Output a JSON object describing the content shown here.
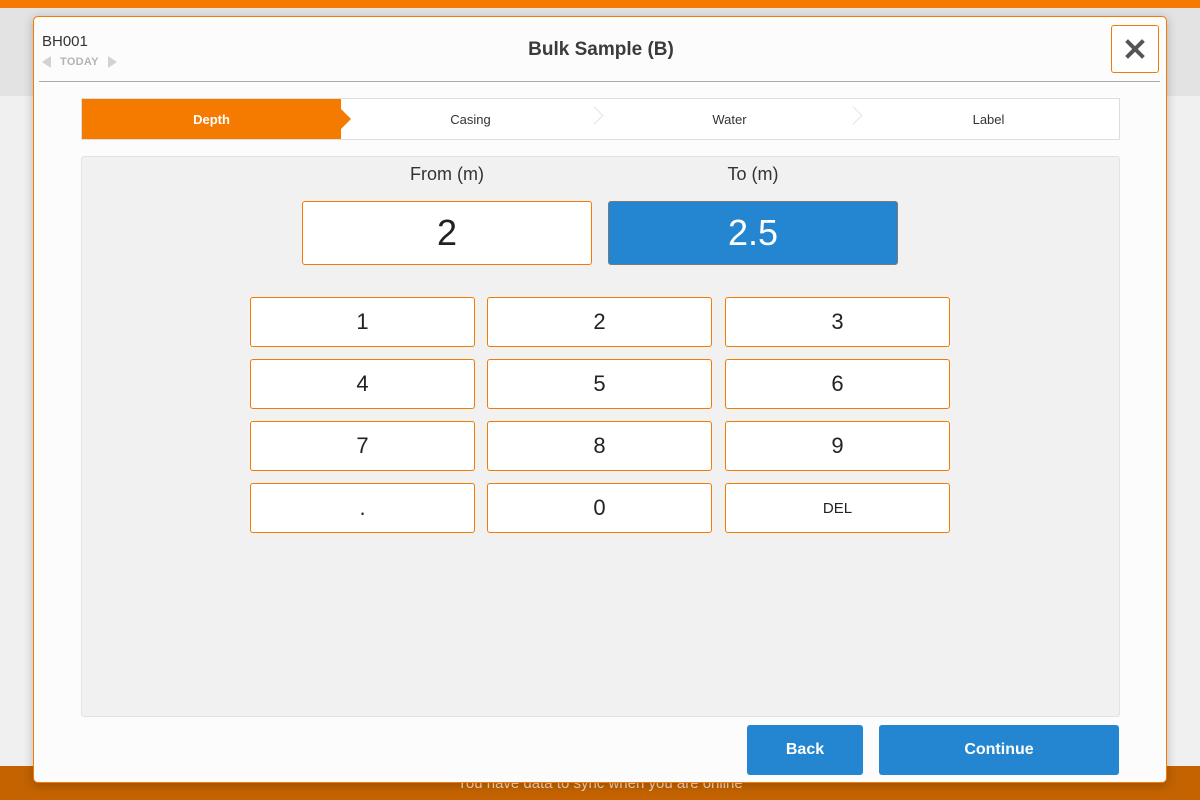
{
  "background": {
    "sync_message": "You have data to sync when you are online"
  },
  "header": {
    "borehole_id": "BH001",
    "date_label": "TODAY",
    "title": "Bulk Sample (B)",
    "close_icon": "close-icon"
  },
  "steps": [
    {
      "label": "Depth",
      "active": true
    },
    {
      "label": "Casing",
      "active": false
    },
    {
      "label": "Water",
      "active": false
    },
    {
      "label": "Label",
      "active": false
    }
  ],
  "depth": {
    "from_label": "From (m)",
    "from_value": "2",
    "to_label": "To (m)",
    "to_value": "2.5"
  },
  "keypad": {
    "keys": [
      "1",
      "2",
      "3",
      "4",
      "5",
      "6",
      "7",
      "8",
      "9",
      ".",
      "0",
      "DEL"
    ]
  },
  "footer": {
    "back_label": "Back",
    "continue_label": "Continue"
  },
  "colors": {
    "accent": "#f47b00",
    "primary": "#2486d0"
  }
}
